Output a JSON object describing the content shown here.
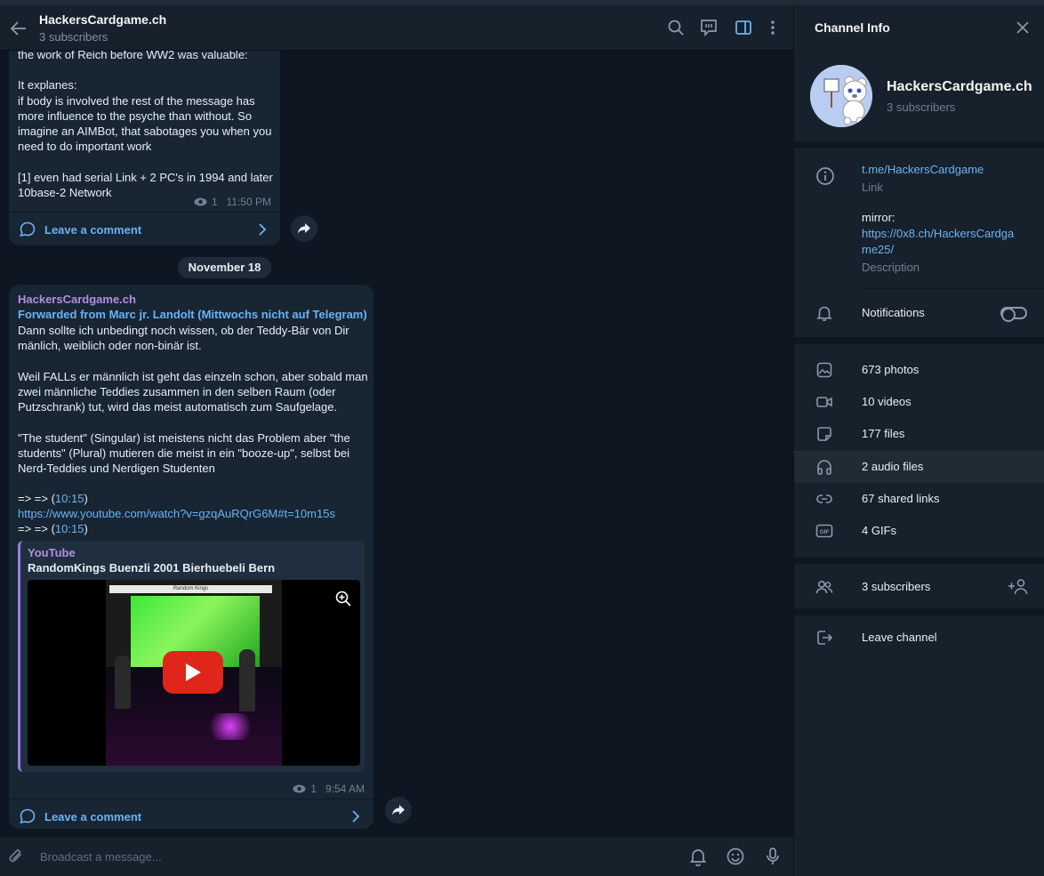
{
  "chat": {
    "title": "HackersCardgame.ch",
    "subscribers": "3 subscribers"
  },
  "message1": {
    "text": "the work of Reich before WW2 was valuable:\n\nIt explanes:\nif body is involved the rest of the message has more influence to the psyche than without. So imagine an AIMBot, that sabotages you when you need to do important work\n\n[1] even had serial Link + 2 PC's in 1994 and later 10base-2 Network",
    "views": "1",
    "time": "11:50 PM",
    "comment_label": "Leave a comment"
  },
  "date_separator": "November 18",
  "message2": {
    "sender": "HackersCardgame.ch",
    "forwarded": "Forwarded from Marc jr. Landolt (Mittwochs nicht auf Telegram)",
    "para1": "Dann sollte ich unbedingt noch wissen, ob der Teddy-Bär von Dir mänlich, weiblich oder non-binär ist.",
    "para2": "Weil FALLs er männlich ist geht das einzeln schon, aber sobald man zwei männliche Teddies zusammen in den selben Raum (oder Putzschrank) tut, wird das meist automatisch zum Saufgelage.",
    "para3": "\"The student\" (Singular) ist meistens nicht das Problem aber \"the students\" (Plural) mutieren die meist in ein \"booze-up\", selbst bei Nerd-Teddies und Nerdigen Studenten",
    "arrow_prefix": "=> => (",
    "timestamp_link": "10:15",
    "arrow_suffix": ")",
    "url": "https://www.youtube.com/watch?v=gzqAuRQrG6M#t=10m15s",
    "preview_site": "YouTube",
    "preview_title": "RandomKings Buenzli 2001 Bierhuebeli Bern",
    "thumb_window_title": "Random Kings",
    "views": "1",
    "time": "9:54 AM",
    "comment_label": "Leave a comment"
  },
  "composer": {
    "placeholder": "Broadcast a message..."
  },
  "panel": {
    "title": "Channel Info",
    "name": "HackersCardgame.ch",
    "subscribers": "3 subscribers",
    "link": "t.me/HackersCardgame",
    "link_caption": "Link",
    "description_text": "mirror:",
    "description_url_line1": "https://0x8.ch/HackersCardga",
    "description_url_line2": "me25/",
    "description_caption": "Description",
    "notifications_label": "Notifications",
    "media": [
      {
        "label": "673 photos",
        "icon": "photo-icon"
      },
      {
        "label": "10 videos",
        "icon": "video-icon"
      },
      {
        "label": "177 files",
        "icon": "file-icon"
      },
      {
        "label": "2 audio files",
        "icon": "headphones-icon"
      },
      {
        "label": "67 shared links",
        "icon": "link-icon"
      },
      {
        "label": "4 GIFs",
        "icon": "gif-icon"
      }
    ],
    "members_label": "3 subscribers",
    "leave_label": "Leave channel"
  },
  "colors": {
    "background": "#0e1621",
    "panel": "#17212b",
    "bubble": "#182533",
    "accent": "#6ab3f3",
    "sender": "#b18ee0"
  }
}
